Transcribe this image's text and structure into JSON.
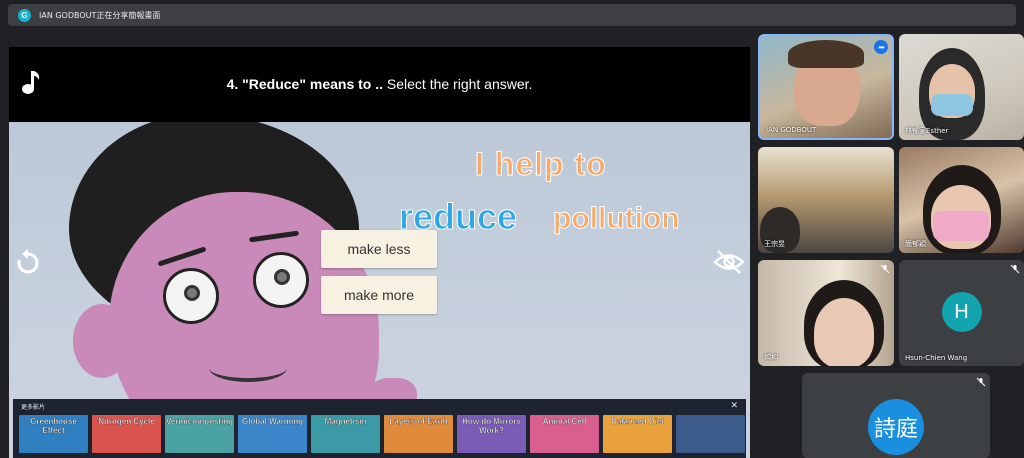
{
  "presenting_bar": {
    "avatar_initial": "G",
    "text": "IAN GODBOUT正在分享簡報畫面"
  },
  "shared_screen": {
    "question_number": "4. \"Reduce\" means to ..",
    "question_instruction": "Select the right answer.",
    "slide_text_line1": "I help to",
    "slide_text_word1": "reduce",
    "slide_text_word2": "pollution",
    "answers": [
      {
        "label": "make less"
      },
      {
        "label": "make more"
      }
    ],
    "icons": {
      "music": "music-note-icon",
      "replay": "replay-icon",
      "hide": "eye-off-icon"
    },
    "more_videos": {
      "label": "更多影片",
      "close": "✕",
      "thumbnails": [
        {
          "title": "Greenhouse Effect",
          "color": "#2f7fc1"
        },
        {
          "title": "Nitrogen Cycle",
          "color": "#d9534f"
        },
        {
          "title": "Vermicomposting",
          "color": "#4aa3a2"
        },
        {
          "title": "Global Warming",
          "color": "#3a86c8"
        },
        {
          "title": "Magnetism",
          "color": "#3b9aa5"
        },
        {
          "title": "Layers of Earth",
          "color": "#e08a3c"
        },
        {
          "title": "How do Mirrors Work?",
          "color": "#7a5bb5"
        },
        {
          "title": "Animal Cell",
          "color": "#d95f8e"
        },
        {
          "title": "Balanced Diet",
          "color": "#e9a23b"
        },
        {
          "title": "",
          "color": "#3c5a8a"
        }
      ]
    }
  },
  "participants": [
    {
      "name": "IAN GODBOUT",
      "more_button": "•••"
    },
    {
      "name": "林郁家Esther"
    },
    {
      "name": "王宗昱"
    },
    {
      "name": "簡郁穎"
    },
    {
      "name": "如如"
    },
    {
      "name": "Hsun-Chien Wang",
      "avatar_letter": "H"
    },
    {
      "name": "",
      "avatar_text": "詩庭"
    }
  ]
}
